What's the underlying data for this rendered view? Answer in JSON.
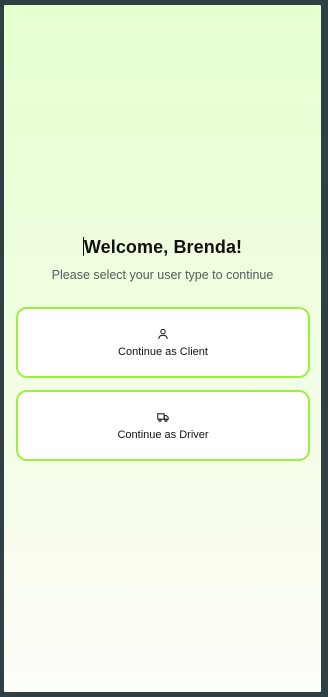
{
  "welcome": {
    "title": "Welcome, Brenda!",
    "subtitle": "Please select your user type to continue"
  },
  "options": [
    {
      "label": "Continue as Client",
      "icon": "user-icon"
    },
    {
      "label": "Continue as Driver",
      "icon": "truck-icon"
    }
  ],
  "colors": {
    "accent_border": "#98f23c",
    "background_top": "#e6ffcf",
    "background_bottom": "#fcfef8",
    "frame": "#2f3f44"
  }
}
